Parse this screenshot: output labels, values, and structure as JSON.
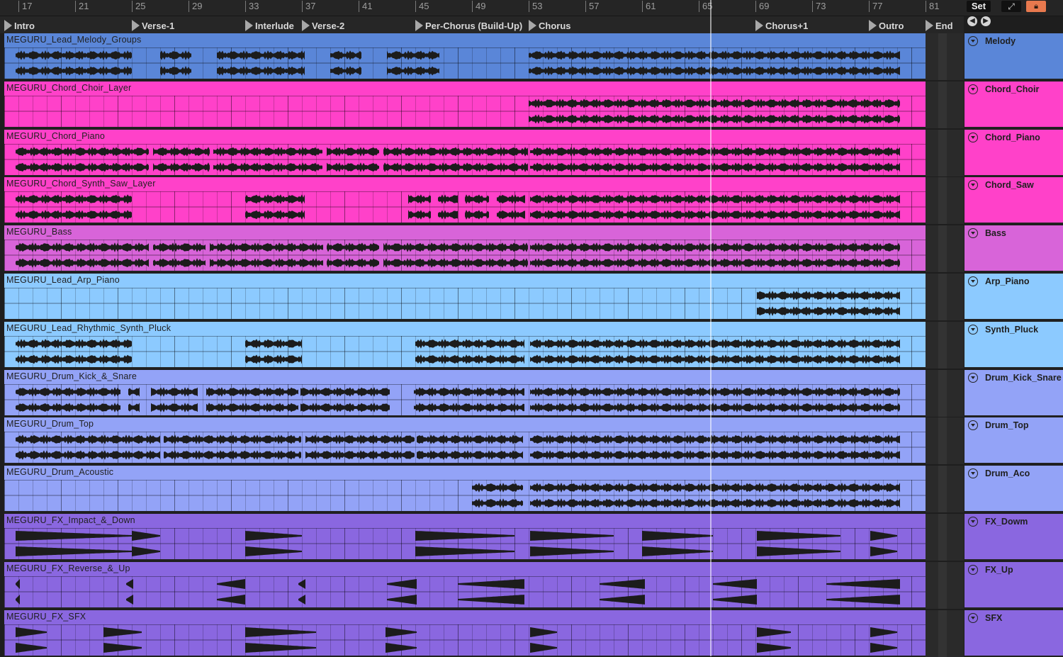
{
  "ruler": {
    "bars": [
      "17",
      "21",
      "25",
      "29",
      "33",
      "37",
      "41",
      "45",
      "49",
      "53",
      "57",
      "61",
      "65",
      "69",
      "73",
      "77",
      "81"
    ]
  },
  "locators": [
    "Intro",
    "Verse-1",
    "Interlude",
    "Verse-2",
    "Per-Chorus (Build-Up)",
    "Chorus",
    "Chorus+1",
    "Outro",
    "End"
  ],
  "controls": {
    "set_label": "Set",
    "expand_icon": "expand-icon",
    "lock_icon": "lock-icon",
    "prev_icon": "arrow-left-icon",
    "next_icon": "arrow-right-icon"
  },
  "colors": {
    "blue": "#5a86d8",
    "pink": "#ff41c9",
    "magenta": "#d864d9",
    "light_blue": "#8ccaff",
    "periwinkle": "#93a3f7",
    "violet": "#8a67e0"
  },
  "tracks": [
    {
      "clip": "MEGURU_Lead_Melody_Groups",
      "name": "Melody",
      "color": "#5a86d8"
    },
    {
      "clip": "MEGURU_Chord_Choir_Layer",
      "name": "Chord_Choir",
      "color": "#ff41c9"
    },
    {
      "clip": "MEGURU_Chord_Piano",
      "name": "Chord_Piano",
      "color": "#ff41c9"
    },
    {
      "clip": "MEGURU_Chord_Synth_Saw_Layer",
      "name": "Chord_Saw",
      "color": "#ff41c9"
    },
    {
      "clip": "MEGURU_Bass",
      "name": "Bass",
      "color": "#d864d9"
    },
    {
      "clip": "MEGURU_Lead_Arp_Piano",
      "name": "Arp_Piano",
      "color": "#8ccaff"
    },
    {
      "clip": "MEGURU_Lead_Rhythmic_Synth_Pluck",
      "name": "Synth_Pluck",
      "color": "#8ccaff"
    },
    {
      "clip": "MEGURU_Drum_Kick_&_Snare",
      "name": "Drum_Kick_Snare",
      "color": "#93a3f7"
    },
    {
      "clip": "MEGURU_Drum_Top",
      "name": "Drum_Top",
      "color": "#93a3f7"
    },
    {
      "clip": "MEGURU_Drum_Acoustic",
      "name": "Drum_Aco",
      "color": "#93a3f7"
    },
    {
      "clip": "MEGURU_FX_Impact_&_Down",
      "name": "FX_Dowm",
      "color": "#8a67e0"
    },
    {
      "clip": "MEGURU_FX_Reverse_&_Up",
      "name": "FX_Up",
      "color": "#8a67e0"
    },
    {
      "clip": "MEGURU_FX_SFX",
      "name": "SFX",
      "color": "#8a67e0"
    }
  ]
}
